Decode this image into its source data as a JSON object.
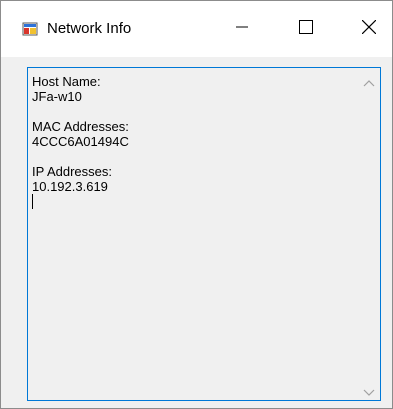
{
  "window": {
    "title": "Network Info",
    "icon": "network-info-app-icon",
    "controls": [
      "minimize-icon",
      "maximize-icon",
      "close-icon"
    ]
  },
  "textbox": {
    "host_label": "Host Name:",
    "host_value": "JFa-w10",
    "mac_label": "MAC Addresses:",
    "mac_value": "4CCC6A01494C",
    "ip_label": "IP Addresses:",
    "ip_value": "10.192.3.619"
  },
  "colors": {
    "focus_border": "#0078d7",
    "window_background": "#f0f0f0",
    "titlebar_background": "#ffffff"
  }
}
